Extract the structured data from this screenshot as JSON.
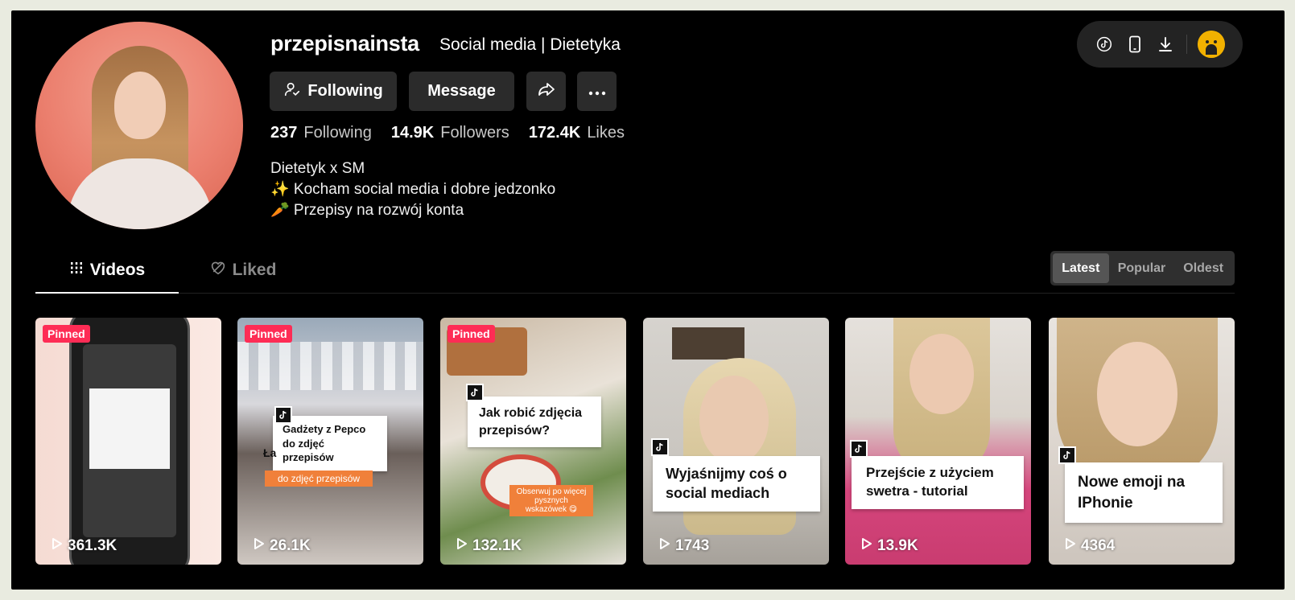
{
  "profile": {
    "username": "przepisnainsta",
    "nickname": "Social media | Dietetyka",
    "buttons": {
      "following_label": "Following",
      "message_label": "Message"
    },
    "stats": [
      {
        "value": "237",
        "label": "Following"
      },
      {
        "value": "14.9K",
        "label": "Followers"
      },
      {
        "value": "172.4K",
        "label": "Likes"
      }
    ],
    "bio": [
      "Dietetyk x SM",
      "✨ Kocham social media i dobre jedzonko",
      "🥕 Przepisy na rozwój konta"
    ]
  },
  "tabs": {
    "videos_label": "Videos",
    "liked_label": "Liked"
  },
  "sort": {
    "options": [
      "Latest",
      "Popular",
      "Oldest"
    ],
    "selected": "Latest"
  },
  "videos": [
    {
      "pinned": "Pinned",
      "views": "361.3K",
      "caption": ""
    },
    {
      "pinned": "Pinned",
      "views": "26.1K",
      "caption": "Gadżety z Pepco do zdjęć przepisów",
      "sub": "do zdjęć przepisów",
      "partial": "Ła"
    },
    {
      "pinned": "Pinned",
      "views": "132.1K",
      "caption": "Jak robić zdjęcia przepisów?",
      "sub": "Obserwuj po więcej pysznych wskazówek 😋"
    },
    {
      "pinned": "",
      "views": "1743",
      "caption": "Wyjaśnijmy coś o social mediach"
    },
    {
      "pinned": "",
      "views": "13.9K",
      "caption": "Przejście z użyciem swetra - tutorial"
    },
    {
      "pinned": "",
      "views": "4364",
      "caption": "Nowe emoji na IPhonie"
    }
  ],
  "colors": {
    "background": "#000000",
    "button": "#2b2b2b",
    "pinned_badge": "#fe2c55",
    "muted_text": "#c8c8c8"
  },
  "icons": [
    "following-person-icon",
    "share-arrow-icon",
    "more-dots-icon",
    "tiktok-icon",
    "phone-icon",
    "download-icon",
    "grid-icon",
    "heart-outline-icon",
    "play-icon"
  ]
}
